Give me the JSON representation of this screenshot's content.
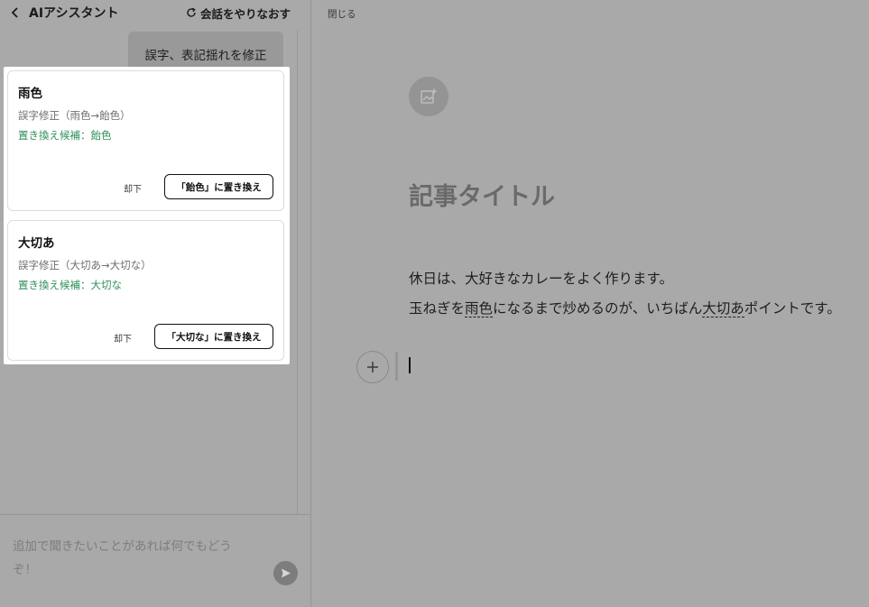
{
  "assistant": {
    "title": "AIアシスタント",
    "restart_label": "会話をやりなおす",
    "user_message": "誤字、表記揺れを修正",
    "suggestions": [
      {
        "word": "雨色",
        "description": "誤字修正（雨色→飴色）",
        "candidate": "置き換え候補：飴色",
        "reject_label": "却下",
        "replace_label": "「飴色」に置き換え"
      },
      {
        "word": "大切あ",
        "description": "誤字修正（大切あ→大切な）",
        "candidate": "置き換え候補：大切な",
        "reject_label": "却下",
        "replace_label": "「大切な」に置き換え"
      }
    ],
    "input_placeholder_line1": "追加で聞きたいことがあれば何でもどう",
    "input_placeholder_line2": "ぞ！"
  },
  "editor": {
    "close_label": "閉じる",
    "title": "記事タイトル",
    "paragraph1": "休日は、大好きなカレーをよく作ります。",
    "paragraph2_a": "玉ねぎを",
    "paragraph2_mark1": "雨色",
    "paragraph2_b": "になるまで炒めるのが、いちばん",
    "paragraph2_mark2": "大切あ",
    "paragraph2_c": "ポイントです。"
  },
  "icons": {
    "back": "chevron-left-icon",
    "restart": "refresh-icon",
    "send": "send-icon",
    "image": "add-image-icon",
    "add_block": "plus-icon"
  },
  "colors": {
    "overlay_bg": "#a9a9a9",
    "candidate_green": "#2f8f5b",
    "card_bg": "#ffffff"
  }
}
